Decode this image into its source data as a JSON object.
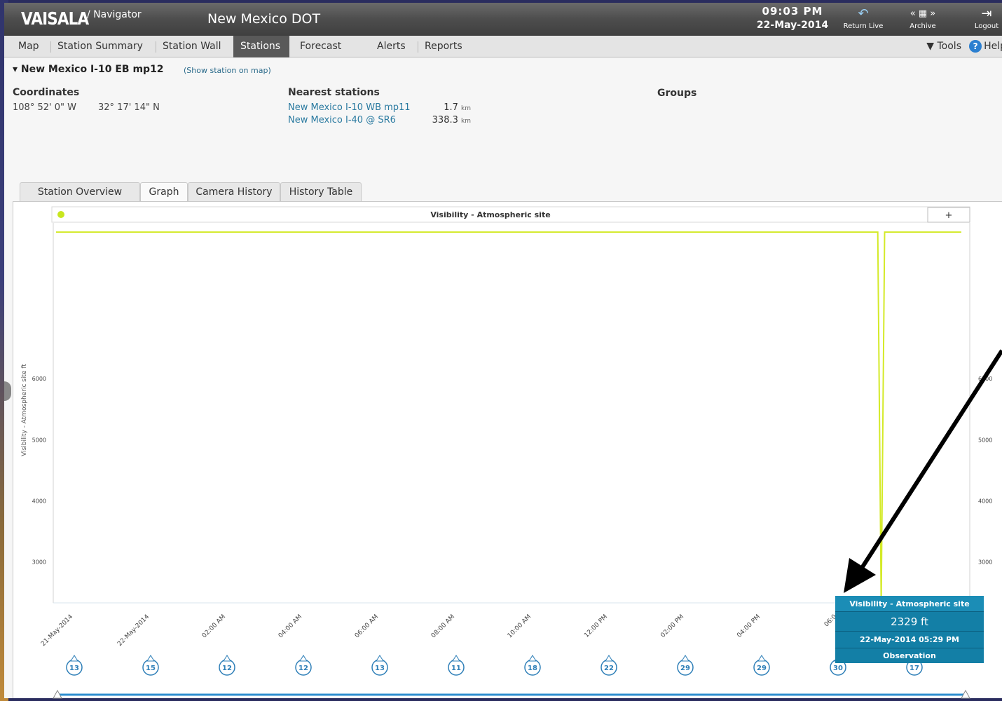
{
  "header": {
    "logo": "VAISALA",
    "logo_sub": "/ Navigator",
    "app_title": "New Mexico DOT",
    "time": "09:03 PM",
    "date": "22-May-2014",
    "return_live_label": "Return Live",
    "archive_label": "Archive",
    "logout_label": "Logout"
  },
  "nav": {
    "items": [
      "Map",
      "Station Summary",
      "Station Wall",
      "Stations",
      "Forecast",
      "Alerts",
      "Reports"
    ],
    "active": "Stations",
    "tools_label": "Tools",
    "help_label": "Help"
  },
  "station": {
    "name": "New Mexico I-10 EB mp12",
    "map_link": "(Show station on map)",
    "coordinates_label": "Coordinates",
    "longitude": "108° 52' 0\" W",
    "latitude": "32° 17' 14\" N",
    "nearest_label": "Nearest stations",
    "nearest": [
      {
        "name": "New Mexico I-10 WB mp11",
        "distance": "1.7",
        "unit": "km"
      },
      {
        "name": "New Mexico I-40 @ SR6",
        "distance": "338.3",
        "unit": "km"
      }
    ],
    "groups_label": "Groups"
  },
  "subtabs": [
    "Station Overview",
    "Graph",
    "Camera History",
    "History Table"
  ],
  "active_subtab": "Graph",
  "graph": {
    "legend_color": "#c8e61e",
    "plus_label": "+",
    "ylabel_left": "Visibility - Atmospheric site ft",
    "line_color": "#d4ea28"
  },
  "chart_data": {
    "type": "line",
    "title": "Visibility - Atmospheric site",
    "ylabel": "Visibility - Atmospheric site ft",
    "ylim": [
      2330,
      8550
    ],
    "yticks": [
      3000,
      4000,
      5000,
      6000
    ],
    "yticks_right": [
      3000,
      4000,
      5000,
      6000
    ],
    "x_tick_labels": [
      "21-May-2014",
      "22-May-2014",
      "02:00 AM",
      "04:00 AM",
      "06:00 AM",
      "08:00 AM",
      "10:00 AM",
      "12:00 PM",
      "02:00 PM",
      "04:00 PM",
      "06:0"
    ],
    "series": [
      {
        "name": "Visibility - Atmospheric site",
        "x": [
          0,
          21.65,
          21.74,
          21.83,
          23.85
        ],
        "y": [
          8400,
          8400,
          2329,
          8400,
          8400
        ]
      }
    ],
    "wind_markers": [
      13,
      15,
      12,
      12,
      13,
      11,
      18,
      22,
      29,
      29,
      30,
      17
    ]
  },
  "tooltip": {
    "title": "Visibility - Atmospheric site",
    "value": "2329 ft",
    "date": "22-May-2014 05:29 PM",
    "type": "Observation"
  }
}
